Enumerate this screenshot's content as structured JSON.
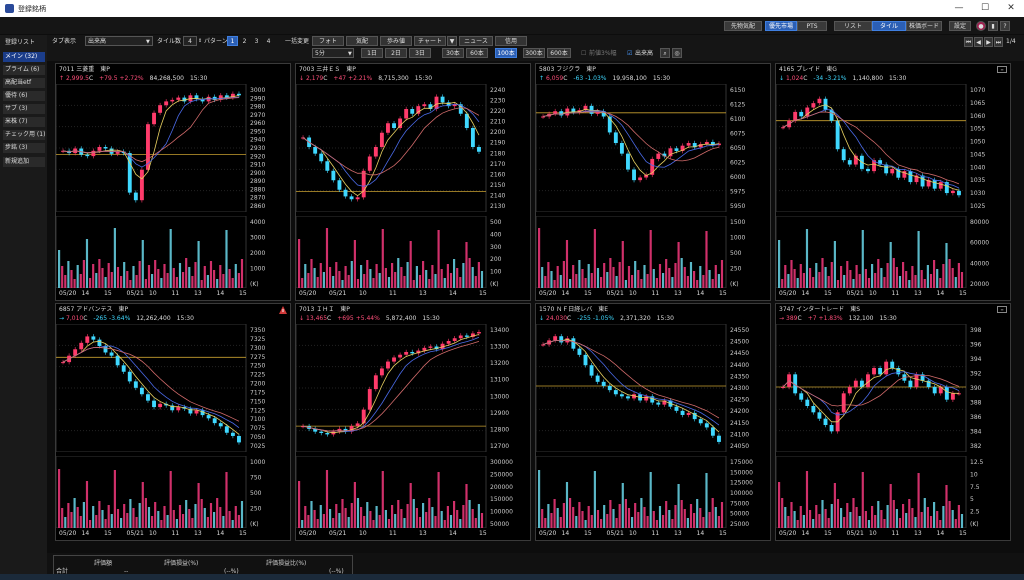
{
  "window": {
    "title": "登録銘柄"
  },
  "header": {
    "buttons": [
      {
        "label": "先物気配",
        "active": false
      },
      {
        "label": "優先市場",
        "active": true
      },
      {
        "label": "PTS",
        "active": false
      },
      {
        "label": "リスト",
        "active": false
      },
      {
        "label": "タイル",
        "active": true
      },
      {
        "label": "株価ボード",
        "active": false
      },
      {
        "label": "設定",
        "active": false
      }
    ],
    "help": "?"
  },
  "sidebar": {
    "heading": "登録リスト",
    "items": [
      {
        "label": "メイン (32)",
        "active": true
      },
      {
        "label": "プライム (6)"
      },
      {
        "label": "高配当etf"
      },
      {
        "label": "優待 (6)"
      },
      {
        "label": "サブ (3)"
      },
      {
        "label": "米株 (7)"
      },
      {
        "label": "チェック用 (1)"
      },
      {
        "label": "步銘 (3)"
      }
    ],
    "add_label": "新規追加"
  },
  "toolbar": {
    "tab_label": "タブ表示",
    "item_select": "出来高",
    "tile_count_label": "タイル数",
    "tile_count": "4",
    "pattern_label": "パターン",
    "patterns": [
      "1",
      "2",
      "3",
      "4"
    ],
    "active_pattern": "1",
    "batch_label": "一括変更",
    "buttons": [
      "フォト",
      "気配",
      "歩み値",
      "チャート",
      "ニュース",
      "信用"
    ],
    "interval": "5分",
    "ranges": [
      "1日",
      "2日",
      "3日",
      "30本",
      "60本",
      "100本",
      "300本",
      "600本"
    ],
    "active_range": "100本",
    "opt1": "前値3%幅",
    "opt2": "出来高",
    "opt2_checked": true,
    "page": "1/4"
  },
  "panes": [
    {
      "code": "7011",
      "name": "三菱重",
      "market": "東P",
      "arrow": "↑",
      "price": "2,999.5",
      "flag": "C",
      "change": "+79.5",
      "pct": "+2.72%",
      "volume": "84,268,500",
      "time": "15:30",
      "dir": "up",
      "price_ticks": [
        "3000",
        "2990",
        "2980",
        "2970",
        "2960",
        "2950",
        "2940",
        "2930",
        "2920",
        "2910",
        "2900",
        "2890",
        "2880",
        "2870",
        "2860"
      ],
      "vol_ticks": [
        "4000",
        "3000",
        "2000",
        "1000",
        "(K)"
      ],
      "dates": [
        "05/20",
        "14",
        "15",
        "05/21",
        "10",
        "11",
        "13",
        "14",
        "15"
      ],
      "ymin": 2855,
      "ymax": 3005,
      "path": [
        2925,
        2922,
        2928,
        2920,
        2918,
        2925,
        2930,
        2928,
        2921,
        2924,
        2922,
        2870,
        2860,
        2900,
        2960,
        2975,
        2985,
        2990,
        2992,
        2995,
        2990,
        2998,
        2993,
        2990,
        2996,
        2992,
        2998,
        2995,
        3000,
        2998
      ],
      "hline": 2920
    },
    {
      "code": "7003",
      "name": "三井ＥＳ",
      "market": "東P",
      "arrow": "↓",
      "price": "2,179",
      "flag": "C",
      "change": "+47",
      "pct": "+2.21%",
      "volume": "8,715,300",
      "time": "15:30",
      "dir": "up",
      "price_ticks": [
        "2240",
        "2230",
        "2220",
        "2210",
        "2200",
        "2190",
        "2180",
        "2170",
        "2160",
        "2150",
        "2140",
        "2130"
      ],
      "vol_ticks": [
        "500",
        "400",
        "300",
        "200",
        "100",
        "(K)"
      ],
      "dates": [
        "05/20",
        "05/21",
        "10",
        "11",
        "13",
        "14",
        "15"
      ],
      "ymin": 2125,
      "ymax": 2245,
      "path": [
        2195,
        2185,
        2178,
        2170,
        2160,
        2150,
        2140,
        2133,
        2130,
        2132,
        2160,
        2175,
        2185,
        2200,
        2210,
        2205,
        2215,
        2225,
        2220,
        2228,
        2230,
        2225,
        2238,
        2232,
        2228,
        2230,
        2220,
        2205,
        2185,
        2180
      ],
      "hline": 2138
    },
    {
      "code": "5803",
      "name": "フジクラ",
      "market": "東P",
      "arrow": "↑",
      "price": "6,059",
      "flag": "C",
      "change": "-63",
      "pct": "-1.03%",
      "volume": "19,958,100",
      "time": "15:30",
      "dir": "dn",
      "price_ticks": [
        "6150",
        "6125",
        "6100",
        "6075",
        "6050",
        "6025",
        "6000",
        "5975",
        "5950"
      ],
      "vol_ticks": [
        "1500",
        "1000",
        "500",
        "250",
        "(K)"
      ],
      "dates": [
        "05/20",
        "14",
        "15",
        "05/21",
        "10",
        "11",
        "13",
        "14",
        "15"
      ],
      "ymin": 5945,
      "ymax": 6160,
      "path": [
        6110,
        6115,
        6120,
        6112,
        6125,
        6118,
        6122,
        6130,
        6115,
        6120,
        6110,
        6080,
        6060,
        6040,
        6010,
        5990,
        5995,
        6000,
        6030,
        6040,
        6035,
        6050,
        6045,
        6055,
        6060,
        6052,
        6058,
        6062,
        6056,
        6059
      ],
      "hline": 6117
    },
    {
      "code": "4165",
      "name": "プレイド",
      "market": "東G",
      "arrow": "↓",
      "price": "1,024",
      "flag": "C",
      "change": "-34",
      "pct": "-3.21%",
      "volume": "1,140,800",
      "time": "15:30",
      "dir": "dn",
      "price_ticks": [
        "1070",
        "1065",
        "1060",
        "1055",
        "1050",
        "1045",
        "1040",
        "1035",
        "1030",
        "1025"
      ],
      "vol_ticks": [
        "80000",
        "60000",
        "40000",
        "20000"
      ],
      "dates": [
        "05/20",
        "14",
        "15",
        "05/21",
        "10",
        "11",
        "13",
        "14",
        "15"
      ],
      "ymin": 1020,
      "ymax": 1072,
      "path": [
        1055,
        1058,
        1062,
        1060,
        1064,
        1066,
        1068,
        1063,
        1058,
        1045,
        1040,
        1038,
        1042,
        1036,
        1035,
        1040,
        1038,
        1034,
        1036,
        1032,
        1035,
        1030,
        1033,
        1028,
        1031,
        1027,
        1030,
        1025,
        1026,
        1024
      ],
      "hline": 1058
    },
    {
      "code": "6857",
      "name": "アドバンテス",
      "market": "東P",
      "arrow": "→",
      "price": "7,010",
      "flag": "C",
      "change": "-265",
      "pct": "-3.64%",
      "volume": "12,262,400",
      "time": "15:30",
      "dir": "dn",
      "price_ticks": [
        "7350",
        "7325",
        "7300",
        "7275",
        "7250",
        "7225",
        "7200",
        "7175",
        "7150",
        "7125",
        "7100",
        "7075",
        "7050",
        "7025"
      ],
      "vol_ticks": [
        "1000",
        "750",
        "500",
        "250",
        "(K)"
      ],
      "dates": [
        "05/20",
        "14",
        "15",
        "05/21",
        "10",
        "11",
        "13",
        "14",
        "15"
      ],
      "ymin": 7005,
      "ymax": 7360,
      "path": [
        7260,
        7280,
        7300,
        7320,
        7340,
        7330,
        7310,
        7290,
        7280,
        7250,
        7230,
        7200,
        7180,
        7160,
        7140,
        7120,
        7130,
        7125,
        7110,
        7120,
        7115,
        7100,
        7110,
        7095,
        7085,
        7070,
        7060,
        7040,
        7030,
        7010
      ],
      "hline": 7275
    },
    {
      "code": "7013",
      "name": "ＩＨＩ",
      "market": "東P",
      "arrow": "↓",
      "price": "13,465",
      "flag": "C",
      "change": "+695",
      "pct": "+5.44%",
      "volume": "5,872,400",
      "time": "15:30",
      "dir": "up",
      "price_ticks": [
        "13400",
        "13300",
        "13200",
        "13100",
        "13000",
        "12900",
        "12800",
        "12700"
      ],
      "vol_ticks": [
        "300000",
        "250000",
        "200000",
        "150000",
        "100000",
        "50000"
      ],
      "dates": [
        "05/20",
        "05/21",
        "10",
        "11",
        "13",
        "14",
        "15"
      ],
      "ymin": 12650,
      "ymax": 13480,
      "path": [
        12780,
        12760,
        12740,
        12730,
        12720,
        12740,
        12760,
        12740,
        12780,
        12800,
        12900,
        13050,
        13150,
        13200,
        13250,
        13280,
        13300,
        13320,
        13310,
        13330,
        13350,
        13360,
        13340,
        13380,
        13400,
        13420,
        13440,
        13430,
        13455,
        13465
      ],
      "hline": 12780
    },
    {
      "code": "1570",
      "name": "ＮＦ日経レバ",
      "market": "東E",
      "arrow": "↓",
      "price": "24,030",
      "flag": "C",
      "change": "-255",
      "pct": "-1.05%",
      "volume": "2,371,320",
      "time": "15:30",
      "dir": "dn",
      "price_ticks": [
        "24550",
        "24500",
        "24450",
        "24400",
        "24350",
        "24300",
        "24250",
        "24200",
        "24150",
        "24100",
        "24050"
      ],
      "vol_ticks": [
        "175000",
        "150000",
        "125000",
        "100000",
        "75000",
        "50000",
        "25000"
      ],
      "dates": [
        "05/20",
        "14",
        "15",
        "05/21",
        "10",
        "11",
        "13",
        "14",
        "15"
      ],
      "ymin": 24020,
      "ymax": 24570,
      "path": [
        24500,
        24520,
        24540,
        24510,
        24530,
        24480,
        24450,
        24400,
        24350,
        24320,
        24300,
        24280,
        24260,
        24250,
        24240,
        24260,
        24230,
        24250,
        24220,
        24210,
        24230,
        24200,
        24180,
        24160,
        24170,
        24140,
        24120,
        24100,
        24060,
        24030
      ],
      "hline": 24300
    },
    {
      "code": "3747",
      "name": "インタートレード",
      "market": "東S",
      "arrow": "→",
      "price": "389",
      "flag": "C",
      "change": "+7",
      "pct": "+1.83%",
      "volume": "132,100",
      "time": "15:30",
      "dir": "up",
      "price_ticks": [
        "398",
        "396",
        "394",
        "392",
        "390",
        "388",
        "386",
        "384",
        "382"
      ],
      "vol_ticks": [
        "12.5",
        "10",
        "7.5",
        "5",
        "2.5",
        "(K)"
      ],
      "dates": [
        "05/20",
        "14",
        "15",
        "05/21",
        "10",
        "11",
        "13",
        "14",
        "15"
      ],
      "ymin": 381,
      "ymax": 399,
      "path": [
        390,
        392,
        389,
        388,
        387,
        386,
        385,
        384,
        383,
        386,
        389,
        390,
        391,
        390,
        392,
        393,
        392,
        394,
        393,
        392,
        391,
        390,
        392,
        391,
        390,
        389,
        390,
        388,
        389,
        389
      ],
      "hline": 390
    }
  ],
  "bottom": {
    "cols": [
      "評価額",
      "評価損益(%)",
      "評価損益比(%)"
    ],
    "row_label": "合計",
    "vals": [
      "--",
      "(--%)",
      "(--%)"
    ]
  }
}
